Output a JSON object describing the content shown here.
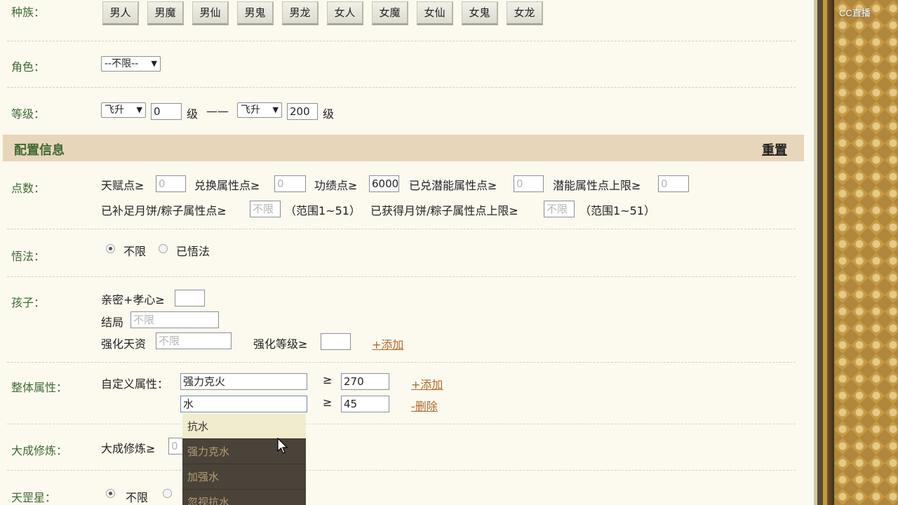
{
  "race": {
    "label": "种族：",
    "options": [
      "男人",
      "男魔",
      "男仙",
      "男鬼",
      "男龙",
      "女人",
      "女魔",
      "女仙",
      "女鬼",
      "女龙"
    ]
  },
  "role": {
    "label": "角色：",
    "selected": "--不限--"
  },
  "level": {
    "label": "等级：",
    "from_type": "飞升",
    "from_value": "0",
    "unit": "级",
    "dash": "——",
    "to_type": "飞升",
    "to_value": "200"
  },
  "config": {
    "title": "配置信息",
    "reset": "重置"
  },
  "points": {
    "label": "点数：",
    "talent": "天赋点≥",
    "talent_ph": "0",
    "exchange": "兑换属性点≥",
    "exchange_ph": "0",
    "merit": "功绩点≥",
    "merit_value": "6000",
    "potential": "已兑潜能属性点≥",
    "potential_ph": "0",
    "potential_cap": "潜能属性点上限≥",
    "potential_cap_ph": "0",
    "mooncake": "已补足月饼/粽子属性点≥",
    "mooncake_ph": "不限",
    "range1": "（范围1~51）",
    "mooncake_cap": "已获得月饼/粽子属性点上限≥",
    "mooncake_cap_ph": "不限",
    "range2": "（范围1~51）"
  },
  "enlight": {
    "label": "悟法：",
    "opt1": "不限",
    "opt2": "已悟法"
  },
  "child": {
    "label": "孩子：",
    "intimacy": "亲密+孝心≥",
    "ending": "结局",
    "ending_ph": "不限",
    "talent": "强化天资",
    "talent_ph": "不限",
    "level": "强化等级≥",
    "add": "+添加"
  },
  "attr": {
    "label": "整体属性：",
    "custom": "自定义属性：",
    "name1": "强力克火",
    "ge": "≥",
    "value1": "270",
    "add": "+添加",
    "name2": "水",
    "value2": "45",
    "remove": "-删除"
  },
  "dropdown": {
    "items": [
      "抗水",
      "强力克水",
      "加强水",
      "忽视抗水"
    ]
  },
  "cultivation": {
    "label": "大成修炼：",
    "text": "大成修炼≥",
    "value": "0"
  },
  "star": {
    "label": "天罡星：",
    "opt1": "不限"
  },
  "brand": {
    "logo": "CC直播"
  }
}
